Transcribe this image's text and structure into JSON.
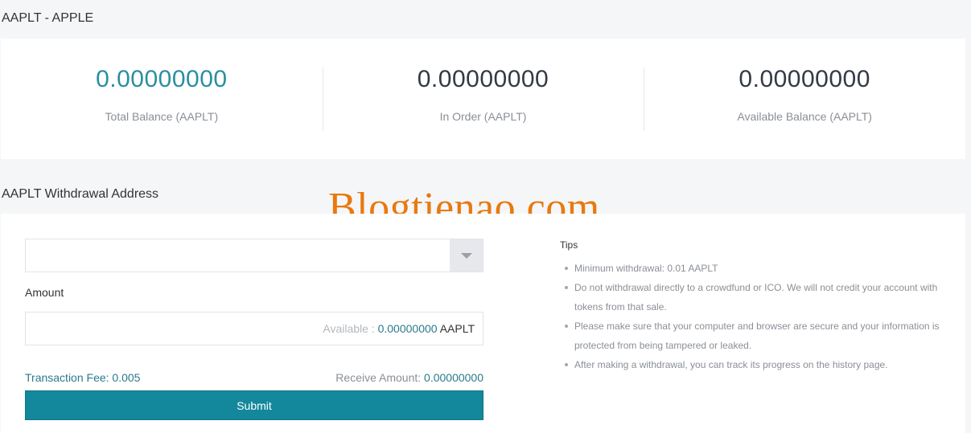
{
  "page": {
    "title": "AAPLT - APPLE",
    "watermark": "Blogtienao.com"
  },
  "balances": [
    {
      "value": "0.00000000",
      "label": "Total Balance (AAPLT)"
    },
    {
      "value": "0.00000000",
      "label": "In Order (AAPLT)"
    },
    {
      "value": "0.00000000",
      "label": "Available Balance (AAPLT)"
    }
  ],
  "withdrawal": {
    "section_title": "AAPLT Withdrawal Address",
    "address_value": "",
    "amount_label": "Amount",
    "amount_value": "",
    "available_prefix": "Available : ",
    "available_value": "0.00000000",
    "available_unit": "AAPLT",
    "fee_text": "Transaction Fee: 0.005",
    "receive_prefix": "Receive Amount: ",
    "receive_value": "0.00000000",
    "submit_label": "Submit"
  },
  "tips": {
    "title": "Tips",
    "items": [
      "Minimum withdrawal: 0.01 AAPLT",
      "Do not withdrawal directly to a crowdfund or ICO. We will not credit your account with tokens from that sale.",
      "Please make sure that your computer and browser are secure and your information is protected from being tampered or leaked.",
      "After making a withdrawal, you can track its progress on the history page."
    ]
  },
  "colors": {
    "accent": "#13889c",
    "accent_text": "#2a8fa0",
    "watermark": "#e8790f"
  }
}
